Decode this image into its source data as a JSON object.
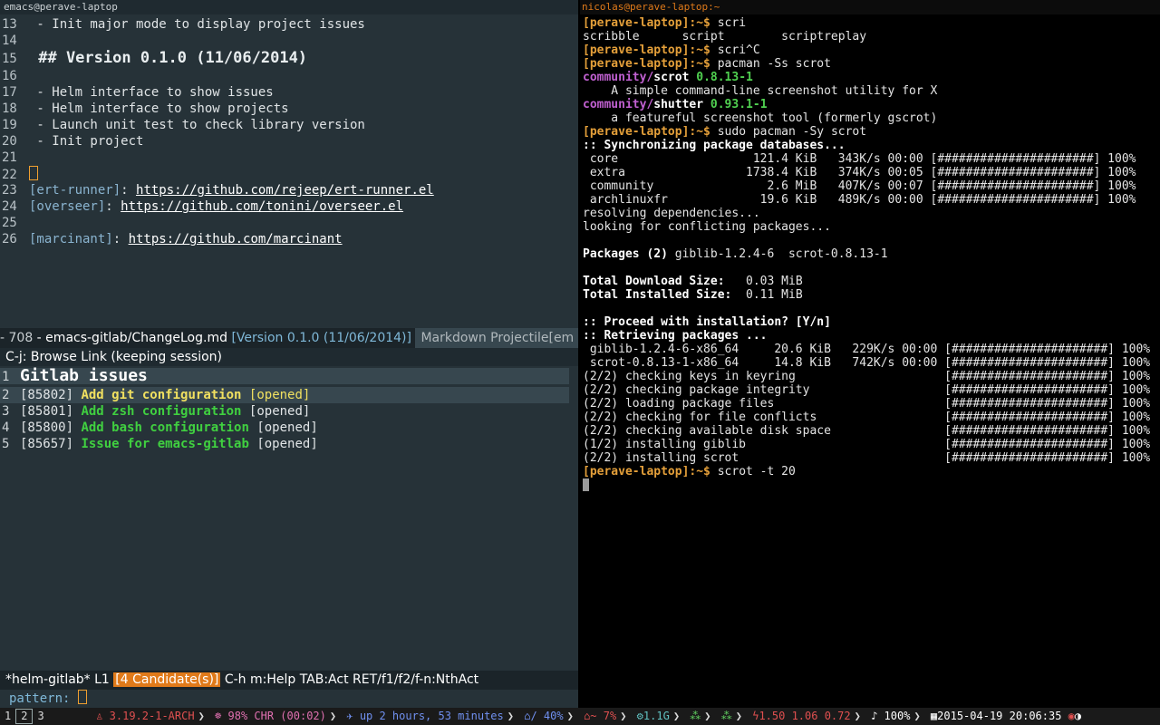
{
  "emacs": {
    "title": "emacs@perave-laptop",
    "lines": [
      {
        "n": "13",
        "text": " - Init major mode to display project issues"
      },
      {
        "n": "14",
        "text": ""
      },
      {
        "n": "15",
        "text": " ## Version 0.1.0 (11/06/2014)"
      },
      {
        "n": "16",
        "text": ""
      },
      {
        "n": "17",
        "text": " - Helm interface to show issues"
      },
      {
        "n": "18",
        "text": " - Helm interface to show projects"
      },
      {
        "n": "19",
        "text": " - Launch unit test to check library version"
      },
      {
        "n": "20",
        "text": " - Init project"
      },
      {
        "n": "21",
        "text": ""
      },
      {
        "n": "22",
        "text": ""
      },
      {
        "n": "23",
        "ref": "[ert-runner]",
        "url": "https://github.com/rejeep/ert-runner.el"
      },
      {
        "n": "24",
        "ref": "[overseer]",
        "url": "https://github.com/tonini/overseer.el"
      },
      {
        "n": "25",
        "text": ""
      },
      {
        "n": "26",
        "ref": "[marcinant]",
        "url": "https://github.com/marcinant"
      }
    ],
    "modeline": {
      "pos": " - 708",
      "file": " - emacs-gitlab/ChangeLog.md",
      "version": "[Version 0.1.0 (11/06/2014)]",
      "modes": "Markdown Projectile[em"
    },
    "helm_hint": "C-j: Browse Link (keeping session)",
    "helm": {
      "title": "Gitlab issues",
      "issues": [
        {
          "n": "2",
          "id": "[85802]",
          "title": "Add git configuration",
          "state": "[opened]"
        },
        {
          "n": "3",
          "id": "[85801]",
          "title": "Add zsh configuration",
          "state": "[opened]"
        },
        {
          "n": "4",
          "id": "[85800]",
          "title": "Add bash configuration",
          "state": "[opened]"
        },
        {
          "n": "5",
          "id": "[85657]",
          "title": "Issue for emacs-gitlab",
          "state": "[opened]"
        }
      ],
      "mode_name": "*helm-gitlab* L1 ",
      "candidates": "[4 Candidate(s)]",
      "mode_help": " C-h m:Help TAB:Act RET/f1/f2/f-n:NthAct",
      "pattern_label": "pattern: "
    }
  },
  "terminal": {
    "title": "nicolas@perave-laptop:~",
    "prompt": "[perave-laptop]:~$",
    "cmd1": " scri",
    "completions": "scribble      script        scriptreplay",
    "cmd2": " scri^C",
    "cmd3": " pacman -Ss scrot",
    "search_results": [
      {
        "repo": "community/",
        "name": "scrot",
        "version": " 0.8.13-1",
        "desc": "    A simple command-line screenshot utility for X"
      },
      {
        "repo": "community/",
        "name": "shutter",
        "version": " 0.93.1-1",
        "desc": "    a featureful screenshot tool (formerly gscrot)"
      }
    ],
    "cmd4": " sudo pacman -Sy scrot",
    "sync_header": ":: Synchronizing package databases...",
    "sync_rows": [
      " core                   121.4 KiB   343K/s 00:00 [######################] 100%",
      " extra                 1738.4 KiB   374K/s 00:05 [######################] 100%",
      " community                2.6 MiB   407K/s 00:07 [######################] 100%",
      " archlinuxfr             19.6 KiB   489K/s 00:00 [######################] 100%"
    ],
    "resolving": "resolving dependencies...",
    "conflicts": "looking for conflicting packages...",
    "packages_label": "Packages (2)",
    "packages_list": " giblib-1.2.4-6  scrot-0.8.13-1",
    "download_label": "Total Download Size:",
    "download_value": "   0.03 MiB",
    "installed_label": "Total Installed Size:",
    "installed_value": "  0.11 MiB",
    "proceed": ":: Proceed with installation? [Y/n]",
    "retrieving": ":: Retrieving packages ...",
    "progress_rows": [
      " giblib-1.2.4-6-x86_64     20.6 KiB   229K/s 00:00 [######################] 100%",
      " scrot-0.8.13-1-x86_64     14.8 KiB   742K/s 00:00 [######################] 100%",
      "(2/2) checking keys in keyring                     [######################] 100%",
      "(2/2) checking package integrity                   [######################] 100%",
      "(2/2) loading package files                        [######################] 100%",
      "(2/2) checking for file conflicts                  [######################] 100%",
      "(2/2) checking available disk space                [######################] 100%",
      "(1/2) installing giblib                            [######################] 100%",
      "(2/2) installing scrot                             [######################] 100%"
    ],
    "cmd5": " scrot -t 20"
  },
  "statusbar": {
    "workspaces": [
      "1",
      "2",
      "3"
    ],
    "active_workspace": "2",
    "kernel": "3.19.2-1-ARCH",
    "battery": "98% CHR (00:02)",
    "uptime": "up 2 hours, 53 minutes",
    "disk": "/ 40%",
    "swap": "~ 7%",
    "mem": "1.1G",
    "load": "1.50 1.06 0.72",
    "volume": "100%",
    "date": "2015-04-19",
    "time": "20:06:35"
  }
}
